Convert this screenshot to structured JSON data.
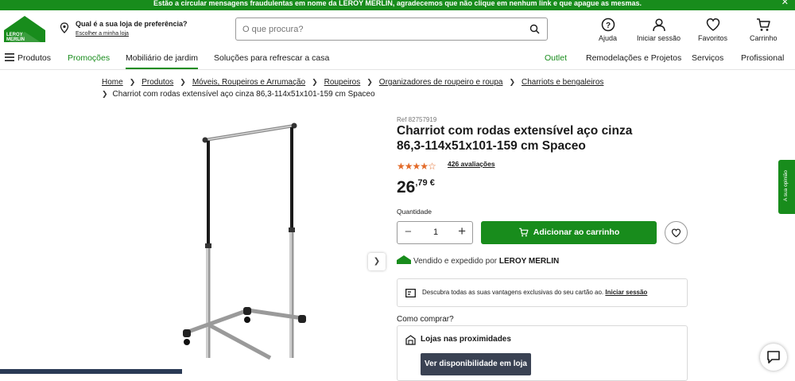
{
  "banner": {
    "text": "Estão a circular mensagens fraudulentas em nome da LEROY MERLIN, agradecemos que não clique em nenhum link e que apague as mesmas.",
    "close_icon": "close-icon"
  },
  "header": {
    "logo_text": "LEROY MERLIN",
    "store_question": "Qual é a sua loja de preferência?",
    "store_choose": "Escolher a minha loja",
    "search_placeholder": "O que procura?",
    "icons": [
      {
        "label": "Ajuda",
        "icon": "help-icon"
      },
      {
        "label": "Iniciar sessão",
        "icon": "user-icon"
      },
      {
        "label": "Favoritos",
        "icon": "heart-icon"
      },
      {
        "label": "Carrinho",
        "icon": "cart-icon"
      }
    ]
  },
  "nav": {
    "products": "Produtos",
    "items": [
      "Promoções",
      "Mobiliário de jardim",
      "Soluções para refrescar a casa"
    ],
    "right_items": [
      "Outlet",
      "Remodelações e Projetos",
      "Serviços",
      "Profissional"
    ]
  },
  "breadcrumb": {
    "items": [
      "Home",
      "Produtos",
      "Móveis, Roupeiros e Arrumação",
      "Roupeiros",
      "Organizadores de roupeiro e roupa",
      "Charriots e bengaleiros"
    ],
    "current": "Charriot com rodas extensível aço cinza 86,3-114x51x101-159 cm Spaceo"
  },
  "product": {
    "ref": "Ref 82757919",
    "title": "Charriot com rodas extensível aço cinza 86,3-114x51x101-159 cm Spaceo",
    "rating": 3.5,
    "rating_max": 5,
    "reviews": "426 avaliações",
    "price_int": "26",
    "price_dec": ",79 €",
    "qty_label": "Quantidade",
    "qty_value": "1",
    "add_to_cart": "Adicionar ao carrinho",
    "sold_by_prefix": "Vendido e expedido por",
    "sold_by": "LEROY MERLIN",
    "card_text": "Descubra todas as suas vantagens exclusivas do seu cartão ao.",
    "card_link": "Iniciar sessão",
    "how_to_buy": "Como comprar?",
    "nearby_stores": "Lojas nas proximidades",
    "availability_button": "Ver disponibilidade em loja"
  },
  "feedback_tab": "A sua opinião",
  "colors": {
    "brand_green": "#188c1c",
    "star_orange": "#e36b2a",
    "dark_button": "#3a4253"
  }
}
